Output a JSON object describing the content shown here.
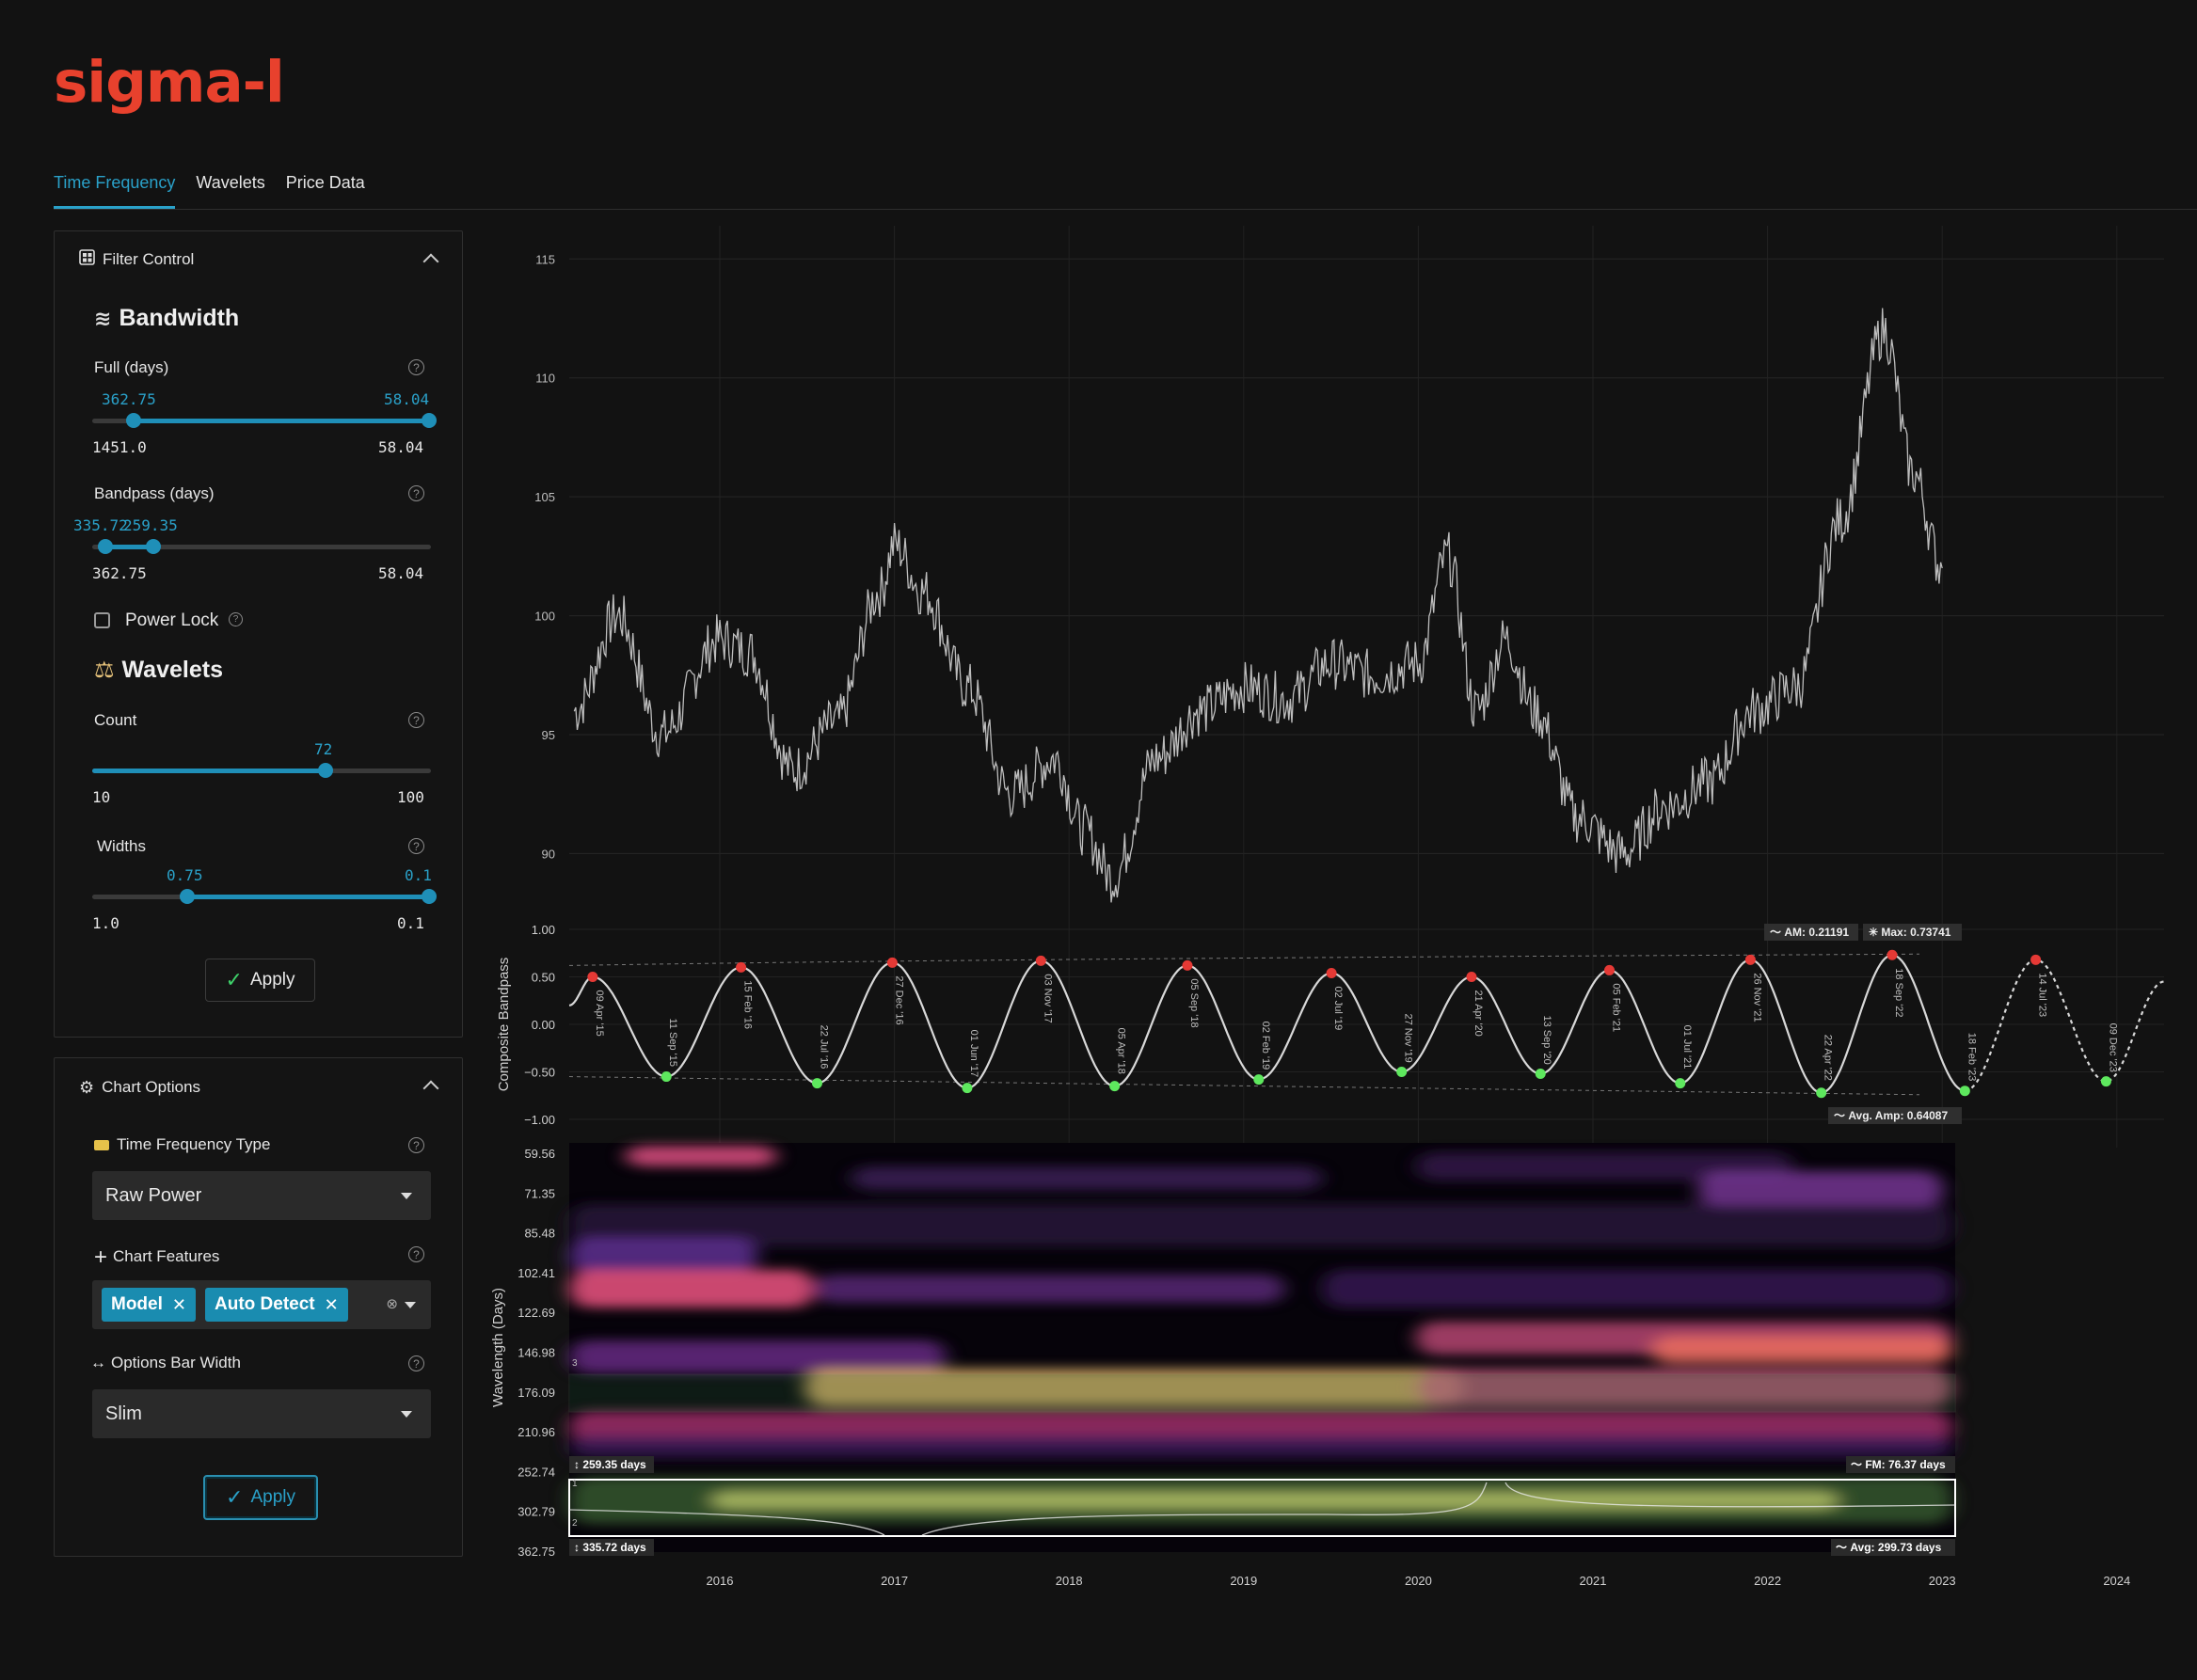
{
  "app": {
    "logo": "sigma-l"
  },
  "tabs": [
    {
      "label": "Time Frequency"
    },
    {
      "label": "Wavelets"
    },
    {
      "label": "Price Data"
    }
  ],
  "filter_control": {
    "title": "Filter Control",
    "bandwidth": {
      "title": "Bandwidth",
      "full": {
        "label": "Full (days)",
        "low_value": "362.75",
        "high_value": "58.04",
        "min": "1451.0",
        "max": "58.04"
      },
      "bandpass": {
        "label": "Bandpass (days)",
        "low_value": "335.72",
        "high_value": "259.35",
        "min": "362.75",
        "max": "58.04"
      },
      "power_lock": "Power Lock"
    },
    "wavelets": {
      "title": "Wavelets",
      "count": {
        "label": "Count",
        "value": "72",
        "min": "10",
        "max": "100"
      },
      "widths": {
        "label": "Widths",
        "low_value": "0.75",
        "high_value": "0.1",
        "min": "1.0",
        "max": "0.1"
      }
    },
    "apply_label": "Apply"
  },
  "chart_options": {
    "title": "Chart Options",
    "tf_type": {
      "label": "Time Frequency Type",
      "value": "Raw Power"
    },
    "features": {
      "label": "Chart Features",
      "chips": [
        "Model",
        "Auto Detect"
      ]
    },
    "bar_width": {
      "label": "Options Bar Width",
      "value": "Slim"
    },
    "apply_label": "Apply"
  },
  "colors": {
    "accent": "#2aa1c9",
    "logo": "#e8412d",
    "peak": "#e53935",
    "trough": "#5ee85e",
    "background": "#121212"
  },
  "chart_data": [
    {
      "type": "line",
      "title": "",
      "xlabel": "",
      "ylabel": "",
      "ylim": [
        88,
        116
      ],
      "y_ticks": [
        90,
        95,
        100,
        105,
        110,
        115
      ],
      "x_ticks": [
        "2016",
        "2017",
        "2018",
        "2019",
        "2020",
        "2021",
        "2022",
        "2023",
        "2024"
      ],
      "grid": true,
      "series": [
        {
          "x": [
            "2015-03",
            "2015-06",
            "2015-09",
            "2016-01",
            "2016-03",
            "2016-06",
            "2016-09",
            "2016-12",
            "2017-01",
            "2017-03",
            "2017-06",
            "2017-09",
            "2017-12",
            "2018-02",
            "2018-04",
            "2018-07",
            "2018-10",
            "2019-01",
            "2019-04",
            "2019-07",
            "2019-10",
            "2020-01",
            "2020-03",
            "2020-05",
            "2020-07",
            "2020-09",
            "2020-12",
            "2021-03",
            "2021-06",
            "2021-09",
            "2021-12",
            "2022-03",
            "2022-06",
            "2022-09",
            "2022-11",
            "2023-01"
          ],
          "values": [
            96,
            100,
            95,
            99,
            98.5,
            93.5,
            95.5,
            101,
            103,
            101,
            97,
            92.5,
            94,
            91,
            89,
            94,
            96,
            97,
            96.5,
            98,
            97.5,
            98,
            102.5,
            96,
            99,
            96,
            91.5,
            90,
            92,
            93,
            96,
            97,
            104,
            112,
            106,
            102
          ]
        }
      ]
    },
    {
      "type": "line",
      "title": "",
      "ylabel": "Composite Bandpass",
      "ylim": [
        -1,
        1
      ],
      "y_ticks": [
        "1.00",
        "0.50",
        "0.00",
        "−0.50",
        "−1.00"
      ],
      "annotations": {
        "am": "AM: 0.21191",
        "max": "Max: 0.73741",
        "avg_amp": "Avg. Amp: 0.64087"
      },
      "peaks": [
        {
          "date": "09 Apr '15",
          "value": 0.5
        },
        {
          "date": "15 Feb '16",
          "value": 0.6
        },
        {
          "date": "27 Dec '16",
          "value": 0.65
        },
        {
          "date": "03 Nov '17",
          "value": 0.67
        },
        {
          "date": "05 Sep '18",
          "value": 0.62
        },
        {
          "date": "02 Jul '19",
          "value": 0.54
        },
        {
          "date": "21 Apr '20",
          "value": 0.5
        },
        {
          "date": "05 Feb '21",
          "value": 0.57
        },
        {
          "date": "26 Nov '21",
          "value": 0.68
        },
        {
          "date": "18 Sep '22",
          "value": 0.73
        },
        {
          "date": "14 Jul '23",
          "value": 0.68
        }
      ],
      "troughs": [
        {
          "date": "11 Sep '15",
          "value": -0.55
        },
        {
          "date": "22 Jul '16",
          "value": -0.62
        },
        {
          "date": "01 Jun '17",
          "value": -0.67
        },
        {
          "date": "05 Apr '18",
          "value": -0.65
        },
        {
          "date": "02 Feb '19",
          "value": -0.58
        },
        {
          "date": "27 Nov '19",
          "value": -0.5
        },
        {
          "date": "13 Sep '20",
          "value": -0.52
        },
        {
          "date": "01 Jul '21",
          "value": -0.62
        },
        {
          "date": "22 Apr '22",
          "value": -0.72
        },
        {
          "date": "18 Feb '23",
          "value": -0.7
        },
        {
          "date": "09 Dec '23",
          "value": -0.6
        }
      ]
    },
    {
      "type": "heatmap",
      "title": "",
      "ylabel": "Wavelength (Days)",
      "y_ticks": [
        "59.56",
        "71.35",
        "85.48",
        "102.41",
        "122.69",
        "146.98",
        "176.09",
        "210.96",
        "252.74",
        "302.79",
        "362.75"
      ],
      "annotations": {
        "band_high": "259.35 days",
        "band_low": "335.72 days",
        "fm": "FM: 76.37 days",
        "avg": "Avg: 299.73 days",
        "marker_3": "3",
        "marker_1": "1",
        "marker_2": "2"
      }
    }
  ]
}
